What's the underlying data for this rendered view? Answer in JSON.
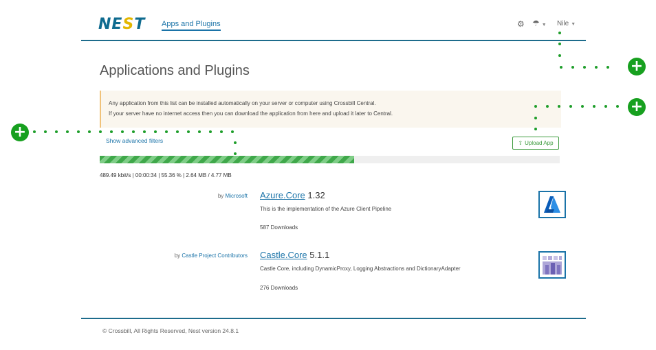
{
  "header": {
    "logo": {
      "left": "NE",
      "mid": "S",
      "right": "T"
    },
    "nav_link": "Apps and Plugins",
    "settings_icon": "gear-icon",
    "weather_icon": "umbrella-icon",
    "user_name": "Nile"
  },
  "page": {
    "title": "Applications and Plugins",
    "notice_line1": "Any application from this list can be installed automatically on your server or computer using Crossbill Central.",
    "notice_line2": "If your server have no internet access then you can download the application from here and upload it later to Central.",
    "advanced_filters": "Show advanced filters",
    "upload_button": "Upload App",
    "progress_percent": 55.36,
    "stats": "489.49 kbit/s | 00:00:34 | 55.36 % | 2.64 MB / 4.77 MB"
  },
  "apps": [
    {
      "by": "by",
      "publisher": "Microsoft",
      "name": "Azure.Core",
      "version": "1.32",
      "description": "This is the implementation of the Azure Client Pipeline",
      "downloads": "587 Downloads",
      "icon": "azure-logo-icon"
    },
    {
      "by": "by",
      "publisher": "Castle Project Contributors",
      "name": "Castle.Core",
      "version": "5.1.1",
      "description": "Castle Core, including DynamicProxy, Logging Abstractions and DictionaryAdapter",
      "downloads": "276 Downloads",
      "icon": "castle-logo-icon"
    }
  ],
  "footer": {
    "text": "© Crossbill, All Rights Reserved, Nest version 24.8.1"
  },
  "annotations": {
    "marker_symbol": "+",
    "color": "#17a01f"
  }
}
